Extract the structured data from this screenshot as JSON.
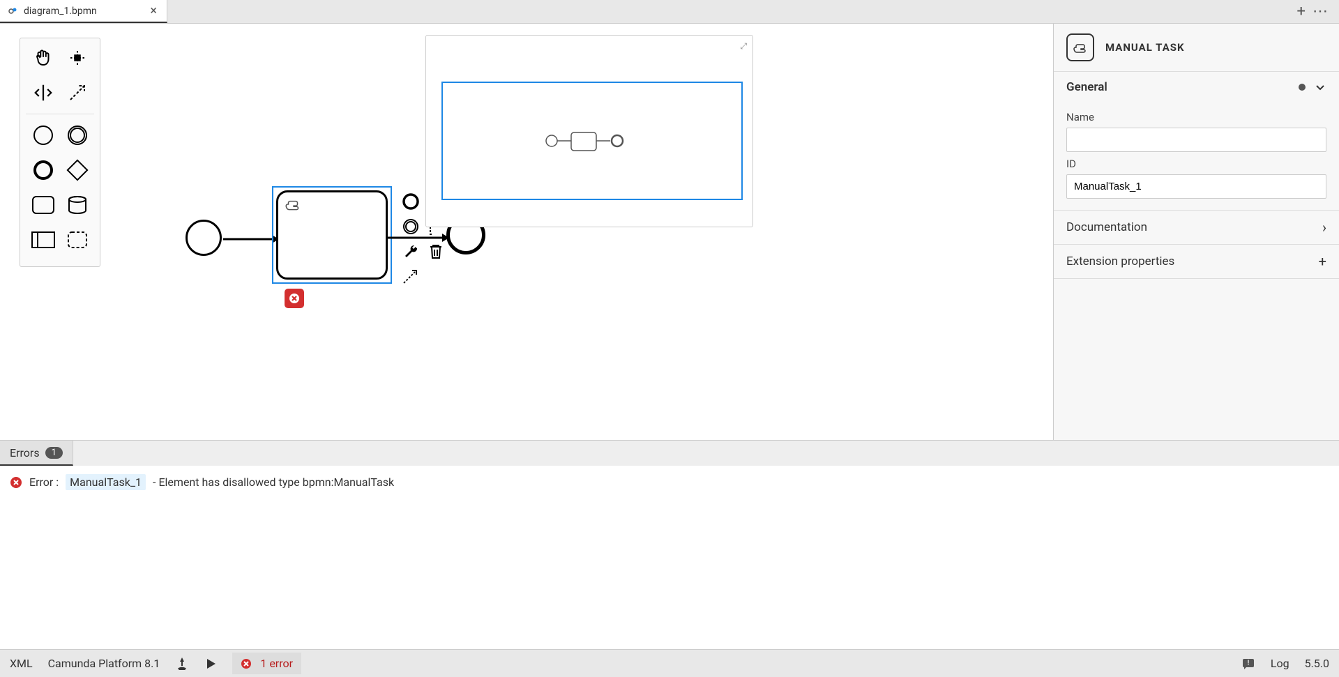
{
  "tab": {
    "title": "diagram_1.bpmn"
  },
  "properties": {
    "header": "MANUAL TASK",
    "general": {
      "title": "General",
      "name_label": "Name",
      "name_value": "",
      "id_label": "ID",
      "id_value": "ManualTask_1"
    },
    "documentation_label": "Documentation",
    "extension_label": "Extension properties"
  },
  "errors_panel": {
    "tab_label": "Errors",
    "count": "1",
    "item": {
      "prefix": "Error :",
      "element_id": "ManualTask_1",
      "message": "- Element has disallowed type bpmn:ManualTask"
    }
  },
  "statusbar": {
    "xml": "XML",
    "platform": "Camunda Platform 8.1",
    "error_count": "1 error",
    "log": "Log",
    "version": "5.5.0"
  }
}
